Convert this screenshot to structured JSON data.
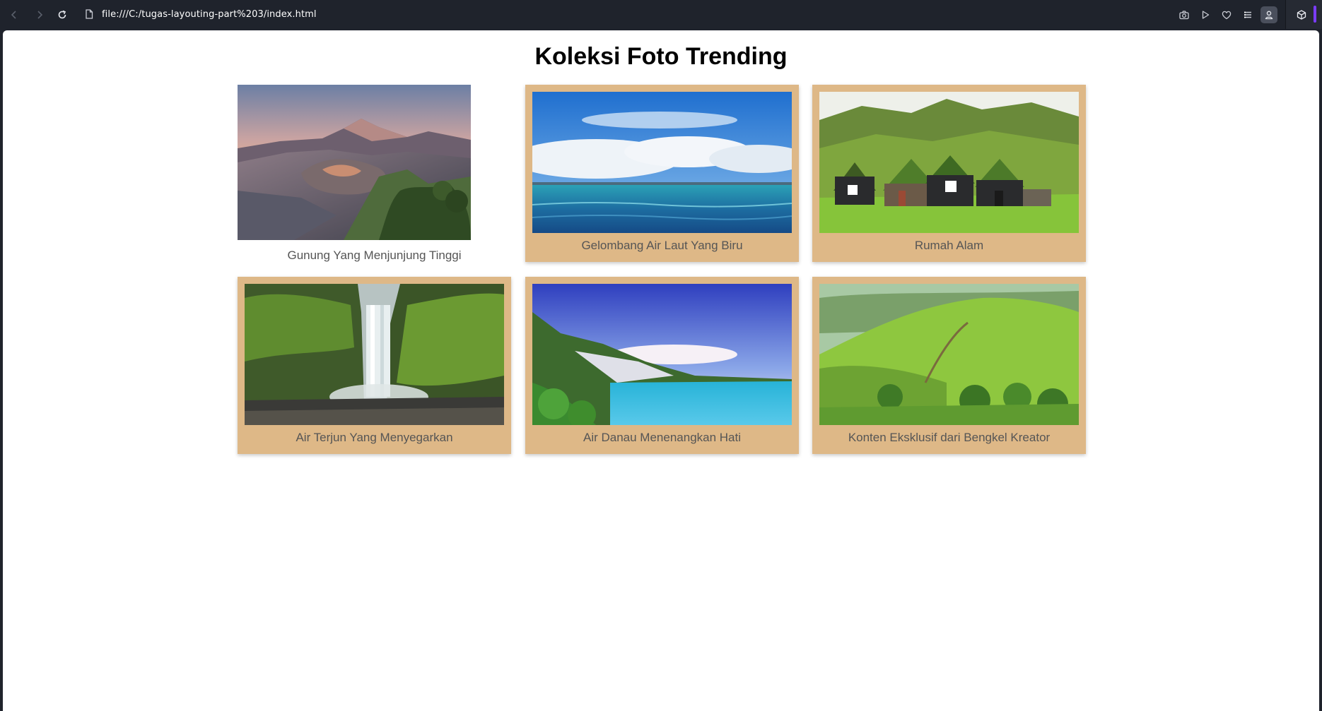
{
  "browser": {
    "url": "file:///C:/tugas-layouting-part%203/index.html",
    "icons": [
      "back-icon",
      "forward-icon",
      "reload-icon",
      "page-info-icon",
      "camera-icon",
      "play-icon",
      "heart-icon",
      "menu-icon",
      "profile-icon",
      "extension-cube-icon"
    ]
  },
  "page": {
    "title": "Koleksi Foto Trending",
    "card_color": "#deb887",
    "cards": [
      {
        "caption": "Gunung Yang Menjunjung Tinggi",
        "image": "volcano-landscape"
      },
      {
        "caption": "Gelombang Air Laut Yang Biru",
        "image": "blue-sea-sky"
      },
      {
        "caption": "Rumah Alam",
        "image": "turf-houses-hills"
      },
      {
        "caption": "Air Terjun Yang Menyegarkan",
        "image": "waterfall-cliffs"
      },
      {
        "caption": "Air Danau Menenangkan Hati",
        "image": "lake-mountains"
      },
      {
        "caption": "Konten Eksklusif dari Bengkel Kreator",
        "image": "green-rolling-hills"
      }
    ]
  }
}
